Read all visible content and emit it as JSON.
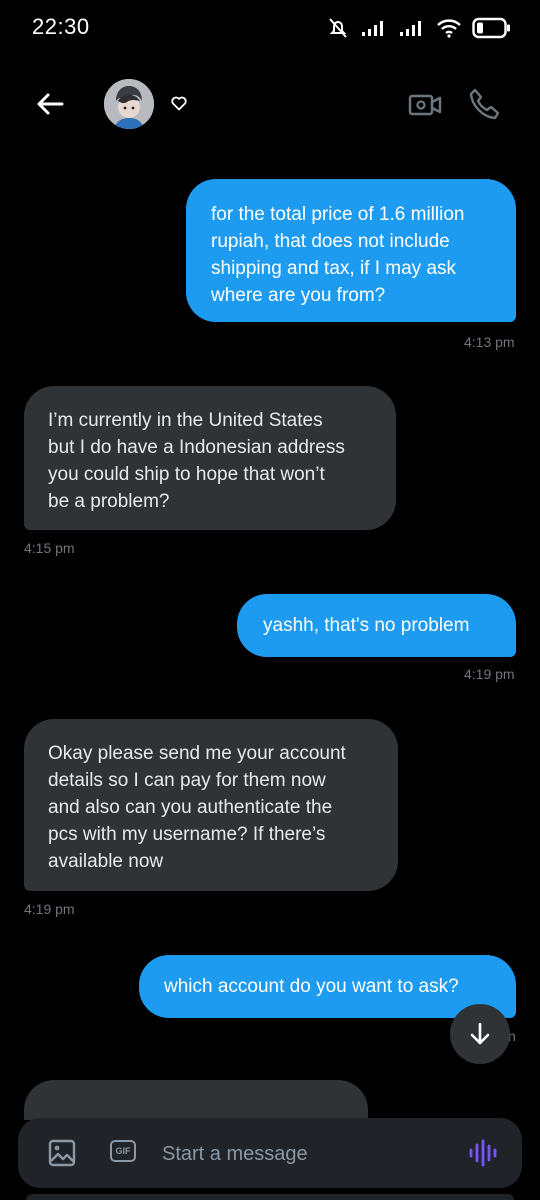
{
  "status_bar": {
    "time": "22:30"
  },
  "header": {
    "back_icon": "arrow-left-icon",
    "verified_icon": "heart-outline-icon",
    "video_icon": "video-camera-icon",
    "phone_icon": "phone-icon"
  },
  "messages": [
    {
      "direction": "outgoing",
      "lines": [
        "for the total price of 1.6 million",
        "rupiah, that does not include",
        "shipping and tax, if I may ask",
        "where are you from?"
      ],
      "time": "4:13 pm"
    },
    {
      "direction": "incoming",
      "lines": [
        "I’m currently in the United States",
        "but I do have a Indonesian address",
        "you could ship to hope that won’t",
        "be a problem?"
      ],
      "time": "4:15 pm"
    },
    {
      "direction": "outgoing",
      "lines": [
        "yashh, that's no problem"
      ],
      "time": "4:19 pm"
    },
    {
      "direction": "incoming",
      "lines": [
        "Okay please send me your account",
        "details so I can pay for them now",
        "and also can you authenticate the",
        "pcs with my username? If there’s",
        "available now"
      ],
      "time": "4:19 pm"
    },
    {
      "direction": "outgoing",
      "lines": [
        "which account do you want to ask?"
      ],
      "time": "n"
    }
  ],
  "composer": {
    "placeholder": "Start a message",
    "gif_label": "GIF",
    "image_icon": "image-icon",
    "voice_icon": "voice-wave-icon"
  },
  "colors": {
    "accent": "#1d9bf0",
    "incoming_bubble": "#2f3336",
    "background": "#000000",
    "voice": "#7856ff"
  }
}
